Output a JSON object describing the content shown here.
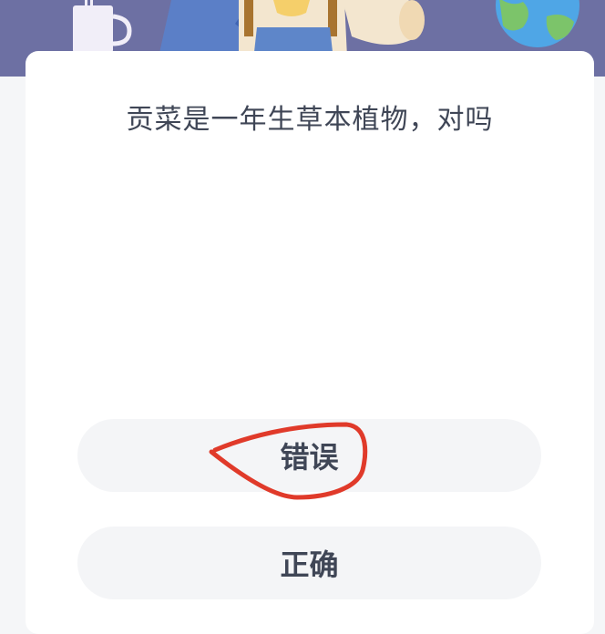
{
  "question": {
    "text": "贡菜是一年生草本植物，对吗"
  },
  "options": [
    {
      "label": "错误",
      "marked": true
    },
    {
      "label": "正确",
      "marked": false
    }
  ],
  "colors": {
    "banner": "#6d70a3",
    "text": "#3f4656",
    "option_bg": "#f4f5f7",
    "annotation": "#e03a2a"
  },
  "icons": {
    "banner_illustration": "cartoon-character-with-cup-and-globe",
    "annotation": "red-hand-drawn-circle-marker"
  }
}
